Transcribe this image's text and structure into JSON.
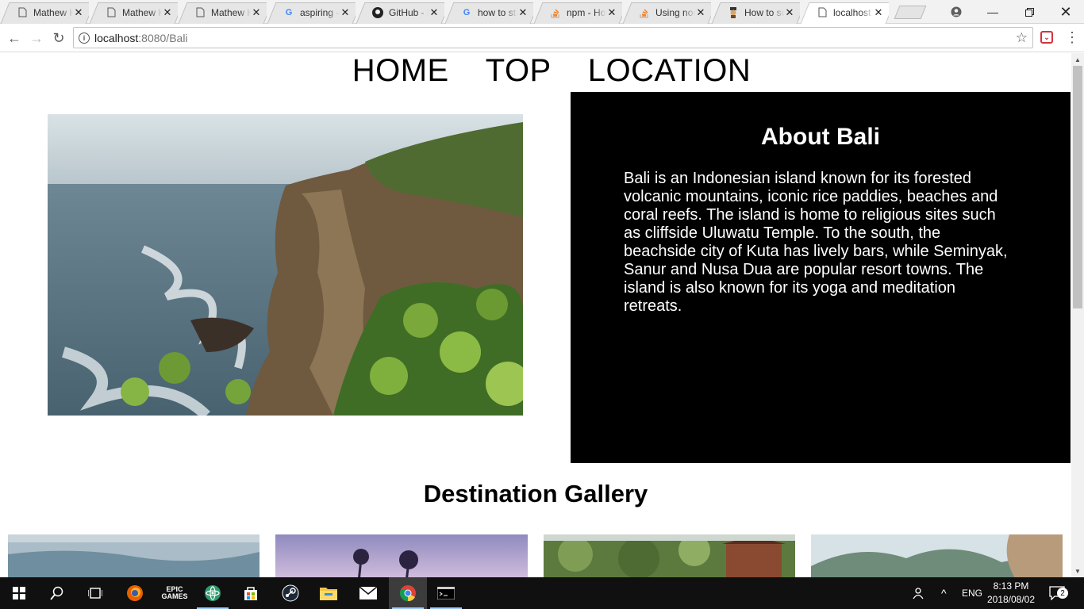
{
  "browser": {
    "tabs": [
      {
        "title": "Mathew K",
        "icon": "page-icon"
      },
      {
        "title": "Mathew K",
        "icon": "page-icon"
      },
      {
        "title": "Mathew K",
        "icon": "page-icon"
      },
      {
        "title": "aspiring -",
        "icon": "google-icon"
      },
      {
        "title": "GitHub - l",
        "icon": "github-icon"
      },
      {
        "title": "how to sta",
        "icon": "google-icon"
      },
      {
        "title": "npm - Ho",
        "icon": "stackoverflow-icon"
      },
      {
        "title": "Using noc",
        "icon": "stackoverflow-icon"
      },
      {
        "title": "How to se",
        "icon": "page-icon"
      },
      {
        "title": "localhost:",
        "icon": "page-icon",
        "active": true
      }
    ],
    "url_host": "localhost",
    "url_path": ":8080/Bali"
  },
  "site": {
    "nav": [
      "HOME",
      "TOP",
      "LOCATION"
    ],
    "about_title": "About Bali",
    "about_text": "Bali is an Indonesian island known for its forested volcanic mountains, iconic rice paddies, beaches and coral reefs. The island is home to religious sites such as cliffside Uluwatu Temple. To the south, the beachside city of Kuta has lively bars, while Seminyak, Sanur and Nusa Dua are popular resort towns. The island is also known for its yoga and meditation retreats.",
    "gallery_title": "Destination Gallery"
  },
  "taskbar": {
    "apps": [
      "start-icon",
      "search-icon",
      "task-view-icon",
      "firefox-icon",
      "epic-games-icon",
      "atom-icon",
      "store-icon",
      "steam-icon",
      "file-explorer-icon",
      "mail-icon",
      "chrome-icon",
      "terminal-icon"
    ],
    "language": "ENG",
    "time": "8:13 PM",
    "date": "2018/08/02",
    "notification_count": "2"
  },
  "colors": {
    "about_bg": "#000000",
    "taskbar_bg": "#101010"
  }
}
